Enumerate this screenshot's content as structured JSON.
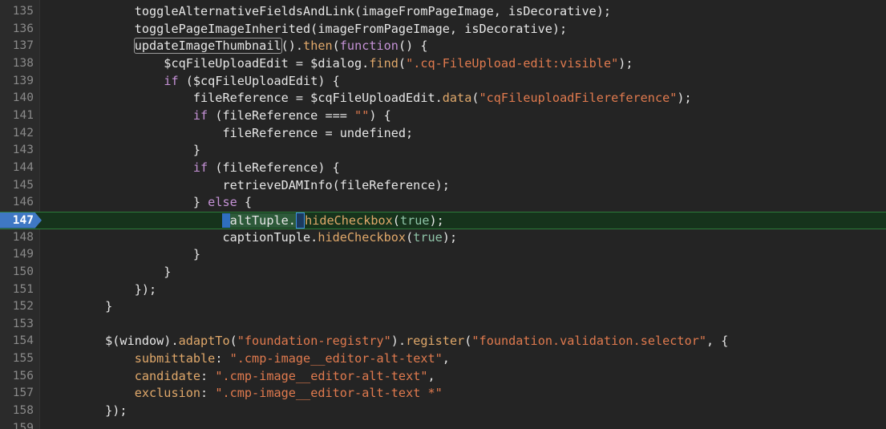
{
  "editor": {
    "current_line": "147",
    "lines": [
      {
        "n": "135",
        "tokens": [
          [
            "plain",
            "            toggleAlternativeFieldsAndLink(imageFromPageImage, isDecorative);"
          ]
        ]
      },
      {
        "n": "136",
        "tokens": [
          [
            "plain",
            "            togglePageImageInherited(imageFromPageImage, isDecorative);"
          ]
        ]
      },
      {
        "n": "137",
        "tokens": [
          [
            "plain",
            "            "
          ],
          [
            "box",
            "updateImageThumbnail"
          ],
          [
            "plain",
            "()."
          ],
          [
            "fn",
            "then"
          ],
          [
            "plain",
            "("
          ],
          [
            "kw",
            "function"
          ],
          [
            "plain",
            "() {"
          ]
        ]
      },
      {
        "n": "138",
        "tokens": [
          [
            "plain",
            "                $cqFileUploadEdit = $dialog."
          ],
          [
            "fn",
            "find"
          ],
          [
            "plain",
            "("
          ],
          [
            "str",
            "\".cq-FileUpload-edit:visible\""
          ],
          [
            "plain",
            ");"
          ]
        ]
      },
      {
        "n": "139",
        "tokens": [
          [
            "plain",
            "                "
          ],
          [
            "kw",
            "if"
          ],
          [
            "plain",
            " ($cqFileUploadEdit) {"
          ]
        ]
      },
      {
        "n": "140",
        "tokens": [
          [
            "plain",
            "                    fileReference = $cqFileUploadEdit."
          ],
          [
            "fn",
            "data"
          ],
          [
            "plain",
            "("
          ],
          [
            "str",
            "\"cqFileuploadFilereference\""
          ],
          [
            "plain",
            ");"
          ]
        ]
      },
      {
        "n": "141",
        "tokens": [
          [
            "plain",
            "                    "
          ],
          [
            "kw",
            "if"
          ],
          [
            "plain",
            " (fileReference === "
          ],
          [
            "str",
            "\"\""
          ],
          [
            "plain",
            ") {"
          ]
        ]
      },
      {
        "n": "142",
        "tokens": [
          [
            "plain",
            "                        fileReference = undefined;"
          ]
        ]
      },
      {
        "n": "143",
        "tokens": [
          [
            "plain",
            "                    }"
          ]
        ]
      },
      {
        "n": "144",
        "tokens": [
          [
            "plain",
            "                    "
          ],
          [
            "kw",
            "if"
          ],
          [
            "plain",
            " (fileReference) {"
          ]
        ]
      },
      {
        "n": "145",
        "tokens": [
          [
            "plain",
            "                        retrieveDAMInfo(fileReference);"
          ]
        ]
      },
      {
        "n": "146",
        "tokens": [
          [
            "plain",
            "                    } "
          ],
          [
            "kw",
            "else"
          ],
          [
            "plain",
            " {"
          ]
        ]
      },
      {
        "n": "147",
        "current": true,
        "tokens": [
          [
            "plain",
            "                        "
          ],
          [
            "cursor",
            " "
          ],
          [
            "hl",
            "altTuple."
          ],
          [
            "cursor2",
            " "
          ],
          [
            "fn",
            "hideCheckbox"
          ],
          [
            "plain",
            "("
          ],
          [
            "val",
            "true"
          ],
          [
            "plain",
            ");"
          ]
        ]
      },
      {
        "n": "148",
        "tokens": [
          [
            "plain",
            "                        captionTuple."
          ],
          [
            "fn",
            "hideCheckbox"
          ],
          [
            "plain",
            "("
          ],
          [
            "val",
            "true"
          ],
          [
            "plain",
            ");"
          ]
        ]
      },
      {
        "n": "149",
        "tokens": [
          [
            "plain",
            "                    }"
          ]
        ]
      },
      {
        "n": "150",
        "tokens": [
          [
            "plain",
            "                }"
          ]
        ]
      },
      {
        "n": "151",
        "tokens": [
          [
            "plain",
            "            });"
          ]
        ]
      },
      {
        "n": "152",
        "tokens": [
          [
            "plain",
            "        }"
          ]
        ]
      },
      {
        "n": "153",
        "tokens": [
          [
            "plain",
            ""
          ]
        ]
      },
      {
        "n": "154",
        "tokens": [
          [
            "plain",
            "        $(window)."
          ],
          [
            "fn",
            "adaptTo"
          ],
          [
            "plain",
            "("
          ],
          [
            "str",
            "\"foundation-registry\""
          ],
          [
            "plain",
            ")."
          ],
          [
            "fn",
            "register"
          ],
          [
            "plain",
            "("
          ],
          [
            "str",
            "\"foundation.validation.selector\""
          ],
          [
            "plain",
            ", {"
          ]
        ]
      },
      {
        "n": "155",
        "tokens": [
          [
            "plain",
            "            "
          ],
          [
            "prop",
            "submittable"
          ],
          [
            "plain",
            ": "
          ],
          [
            "str",
            "\".cmp-image__editor-alt-text\""
          ],
          [
            "plain",
            ","
          ]
        ]
      },
      {
        "n": "156",
        "tokens": [
          [
            "plain",
            "            "
          ],
          [
            "prop",
            "candidate"
          ],
          [
            "plain",
            ": "
          ],
          [
            "str",
            "\".cmp-image__editor-alt-text\""
          ],
          [
            "plain",
            ","
          ]
        ]
      },
      {
        "n": "157",
        "tokens": [
          [
            "plain",
            "            "
          ],
          [
            "prop",
            "exclusion"
          ],
          [
            "plain",
            ": "
          ],
          [
            "str",
            "\".cmp-image__editor-alt-text *\""
          ]
        ]
      },
      {
        "n": "158",
        "tokens": [
          [
            "plain",
            "        });"
          ]
        ]
      },
      {
        "n": "159",
        "tokens": [
          [
            "plain",
            ""
          ]
        ]
      }
    ]
  },
  "colors": {
    "background": "#242424",
    "current_line_bg": "#16331c",
    "breakpoint_marker": "#3f78c4",
    "keyword": "#c592d6",
    "function": "#e0a86a",
    "string": "#e07a4e",
    "boolean": "#8fc4a8"
  }
}
